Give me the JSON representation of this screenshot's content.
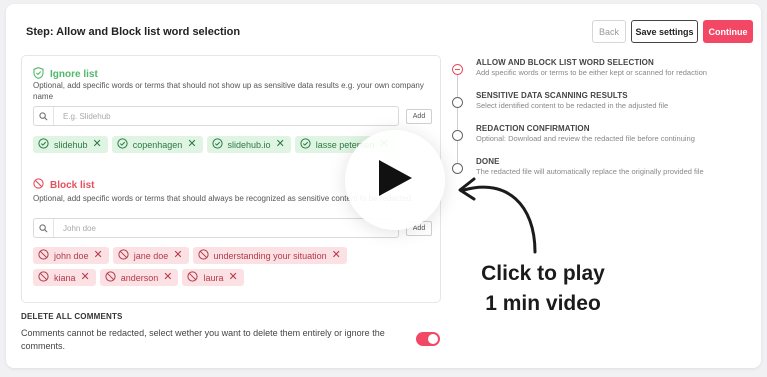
{
  "header": {
    "step_title": "Step: Allow and Block list word selection",
    "back_label": "Back",
    "save_label": "Save settings",
    "continue_label": "Continue"
  },
  "ignore": {
    "title": "Ignore list",
    "description": "Optional, add specific words or terms that should not show up as sensitive data results e.g. your own company name",
    "placeholder": "E.g. Slidehub",
    "add_label": "Add",
    "items": [
      "slidehub",
      "copenhagen",
      "slidehub.io",
      "lasse petersen"
    ]
  },
  "block": {
    "title": "Block list",
    "description": "Optional, add specific words or terms that should always be recognized as sensitive content to be redacted.",
    "placeholder": "John doe",
    "add_label": "Add",
    "items": [
      "john doe",
      "jane doe",
      "understanding your situation",
      "kiana",
      "anderson",
      "laura"
    ]
  },
  "comments": {
    "title": "DELETE ALL COMMENTS",
    "description": "Comments cannot be redacted, select wether you want to delete them entirely or ignore the comments.",
    "enabled": true
  },
  "steps": [
    {
      "title": "ALLOW AND BLOCK LIST WORD SELECTION",
      "desc": "Add specific words or terms to be either kept or scanned for redaction",
      "active": true
    },
    {
      "title": "SENSITIVE DATA SCANNING RESULTS",
      "desc": "Select identified content to be redacted in the adjusted file",
      "active": false
    },
    {
      "title": "REDACTION CONFIRMATION",
      "desc": "Optional: Download and review the redacted file before continuing",
      "active": false
    },
    {
      "title": "DONE",
      "desc": "The redacted file will automatically replace the originally provided file",
      "active": false
    }
  ],
  "overlay": {
    "cta_line1": "Click to play",
    "cta_line2": "1 min video"
  },
  "colors": {
    "accent": "#f24866",
    "ignore_green": "#4fb86a",
    "block_red": "#e5505e"
  },
  "icons": {
    "ignore": "shield-check-icon",
    "block": "block-circle-icon",
    "search": "search-icon",
    "play": "play-icon"
  }
}
